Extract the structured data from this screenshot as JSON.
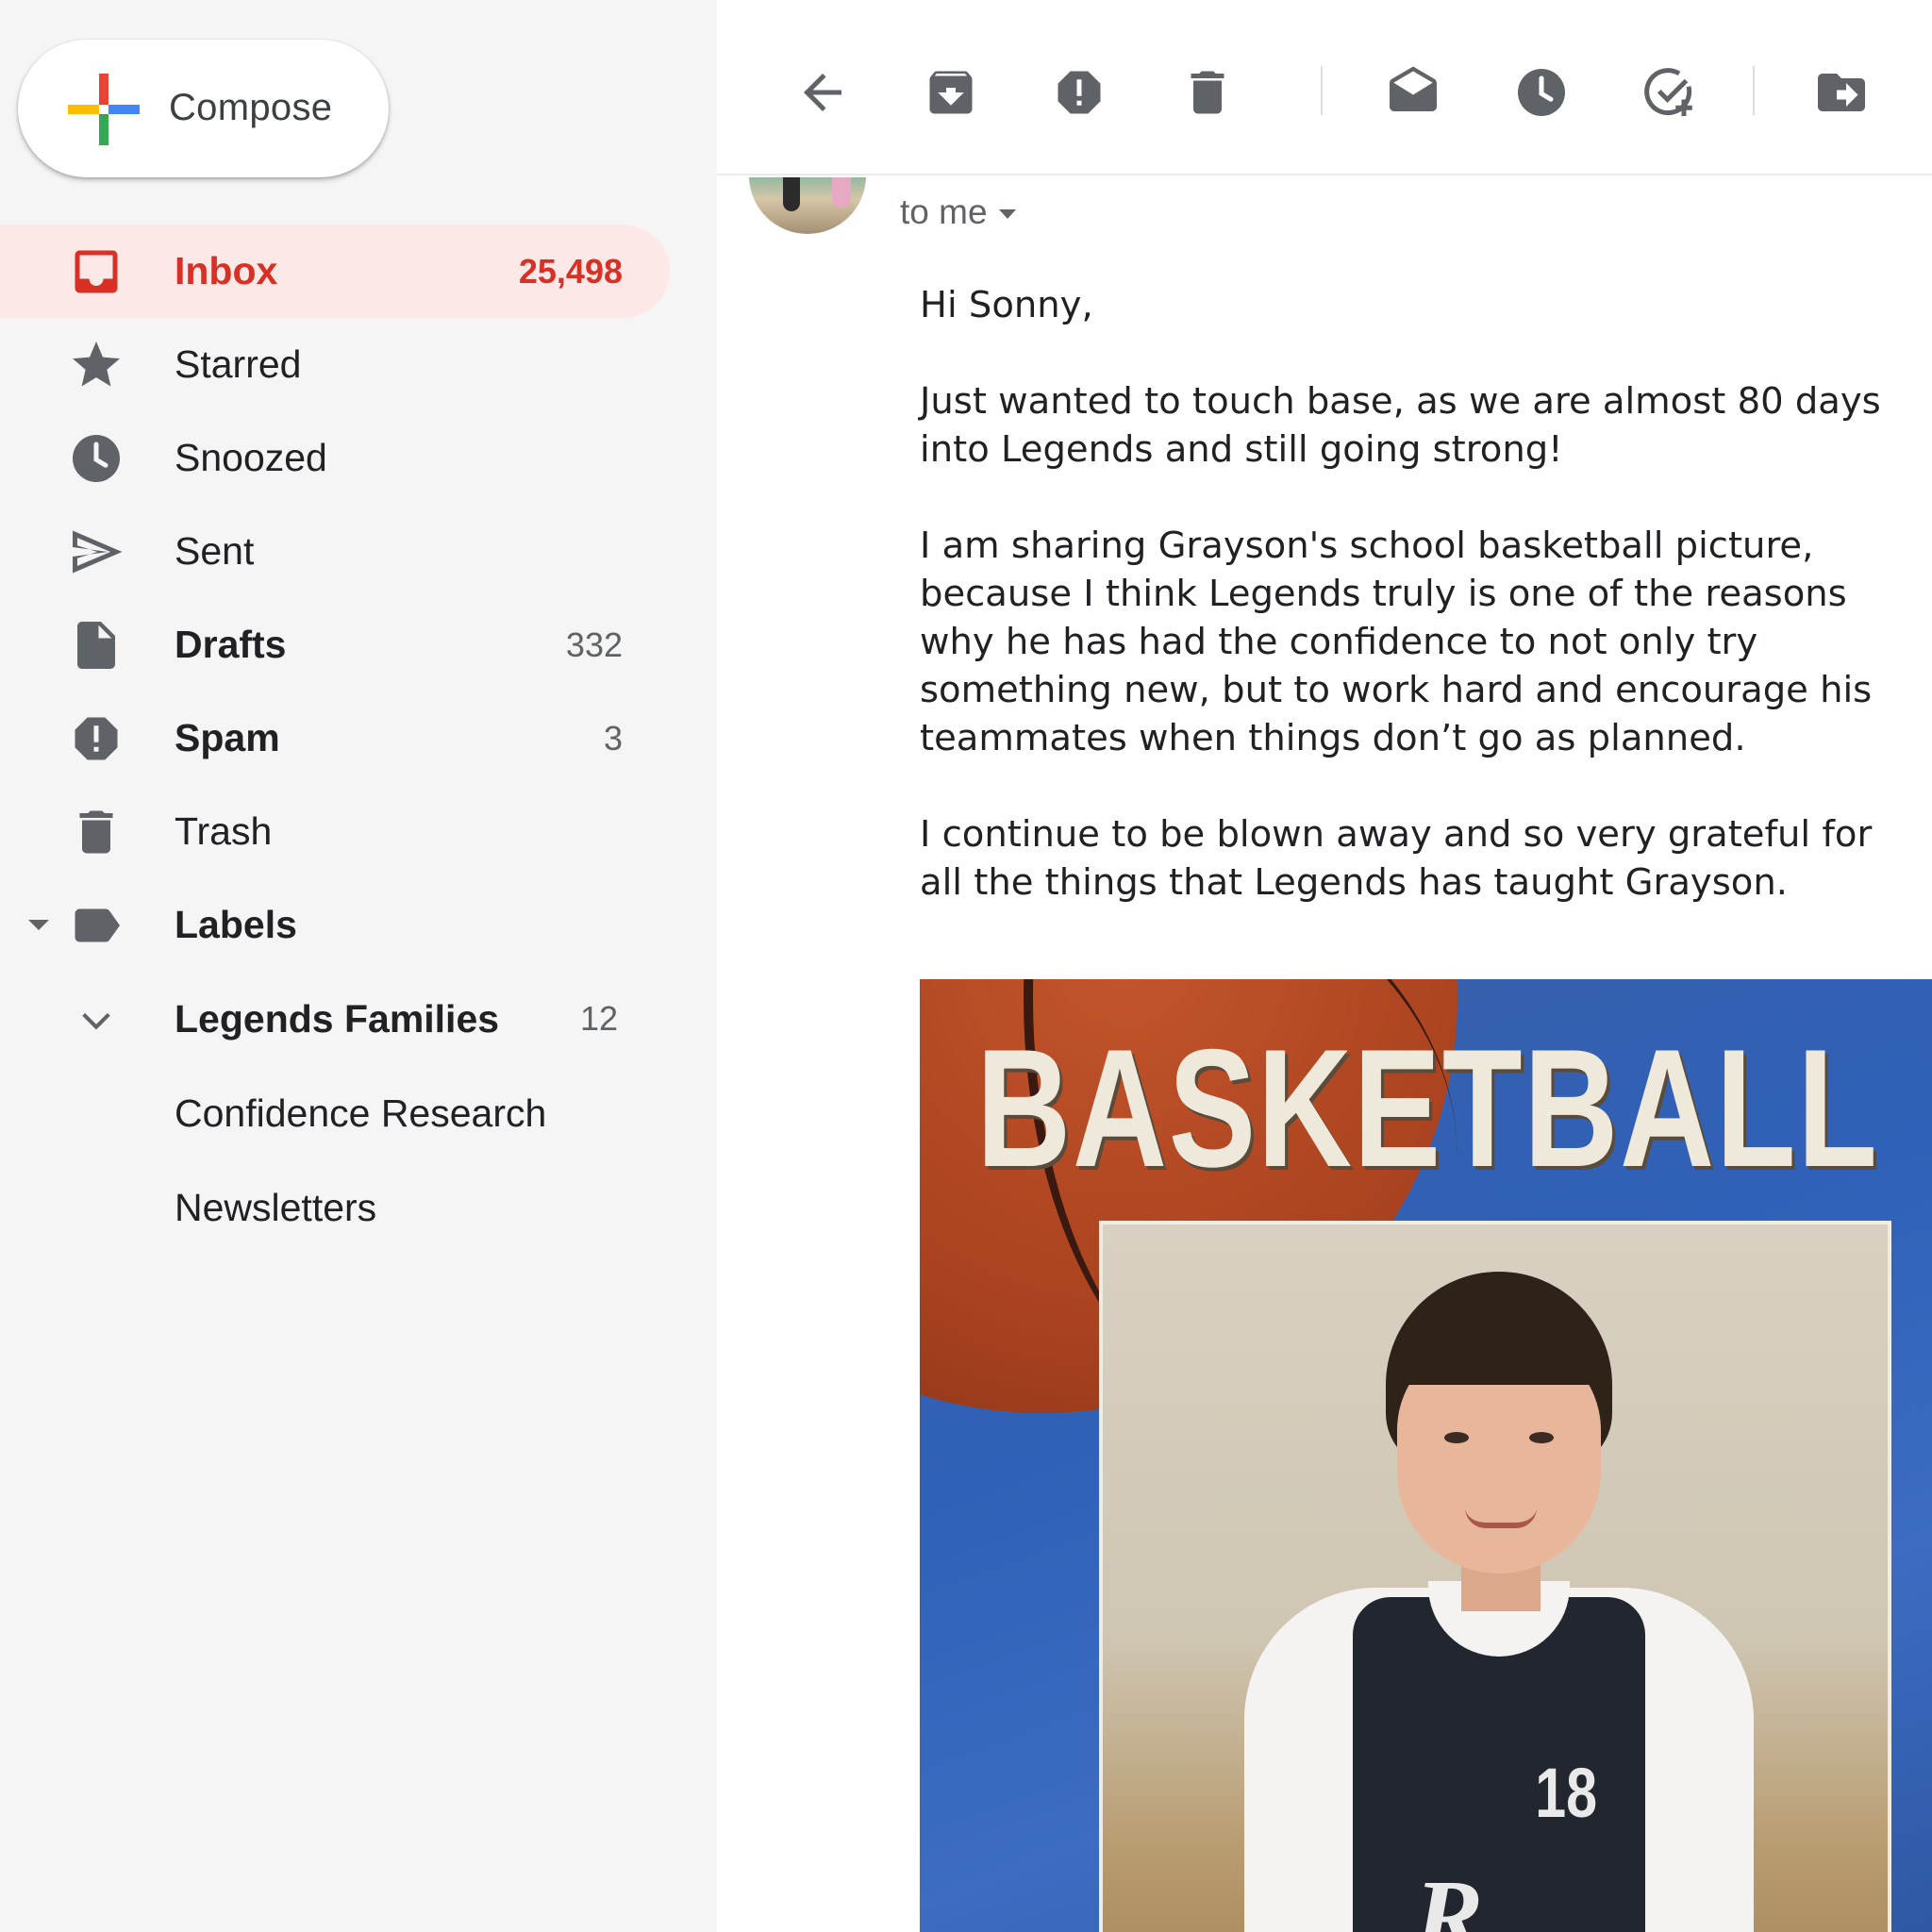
{
  "compose": {
    "label": "Compose"
  },
  "nav": {
    "inbox": {
      "label": "Inbox",
      "count": "25,498"
    },
    "starred": {
      "label": "Starred",
      "count": ""
    },
    "snoozed": {
      "label": "Snoozed",
      "count": ""
    },
    "sent": {
      "label": "Sent",
      "count": ""
    },
    "drafts": {
      "label": "Drafts",
      "count": "332"
    },
    "spam": {
      "label": "Spam",
      "count": "3"
    },
    "trash": {
      "label": "Trash",
      "count": ""
    },
    "labels": {
      "label": "Labels"
    }
  },
  "labels": [
    {
      "label": "Legends Families",
      "count": "12"
    },
    {
      "label": "Confidence Research",
      "count": ""
    },
    {
      "label": "Newsletters",
      "count": ""
    }
  ],
  "toolbar": {
    "icons": [
      "back-arrow-icon",
      "archive-icon",
      "report-spam-icon",
      "delete-icon",
      "mark-unread-icon",
      "snooze-icon",
      "add-task-icon",
      "move-to-icon"
    ]
  },
  "message": {
    "recipient": "to me",
    "body": [
      "Hi Sonny,",
      "Just wanted to touch base, as we are almost 80 days into Legends and still going strong!",
      "I am sharing Grayson's school basketball picture, because I think Legends truly is one of the reasons why he has had the confidence to not only try something new, but to work hard and encourage his teammates when things don’t go as planned.",
      "I continue to be blown away and so very grateful for all the things that Legends has taught Grayson."
    ],
    "image": {
      "title": "BASKETBALL",
      "jersey_number": "18",
      "jersey_logo": "R"
    }
  },
  "colors": {
    "accent_red": "#d93025",
    "active_bg": "#fce8e6",
    "sidebar_bg": "#f5f5f5",
    "icon_gray": "#5f6368"
  }
}
